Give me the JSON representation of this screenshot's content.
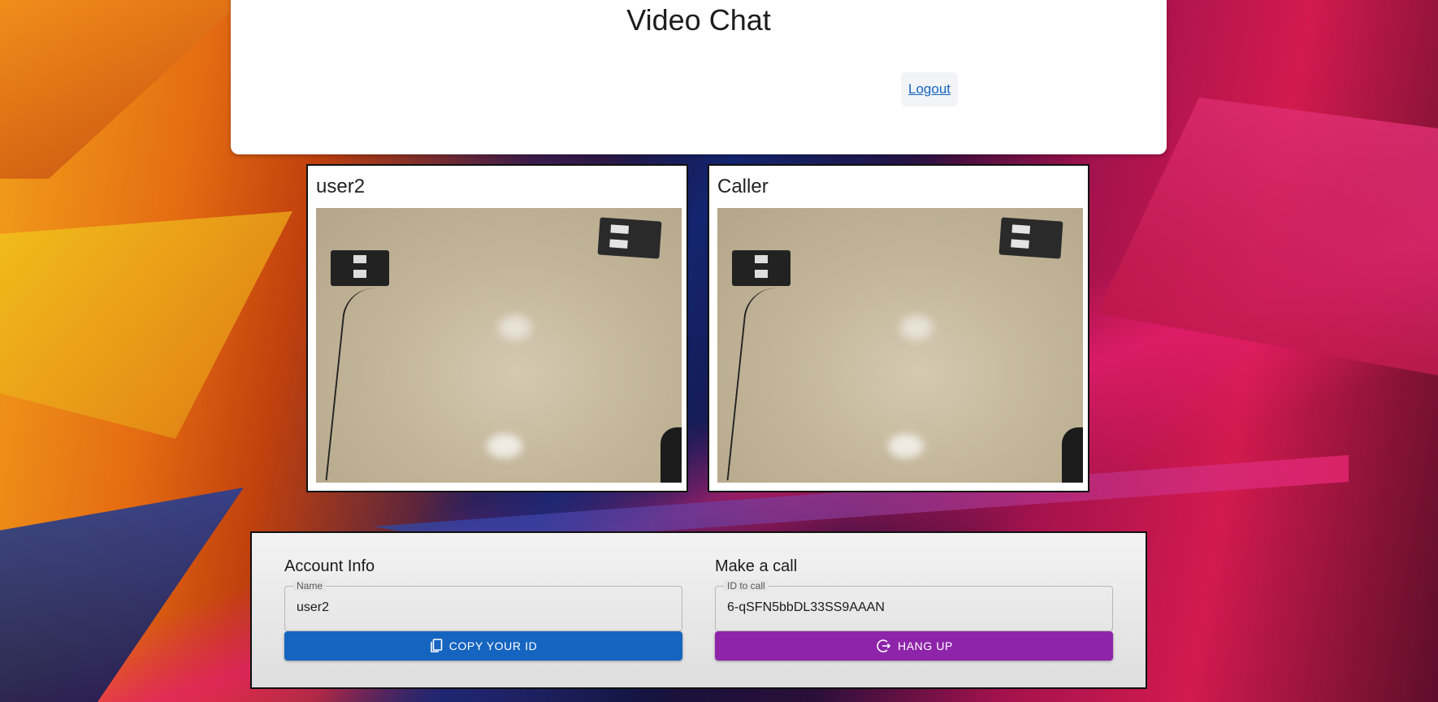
{
  "header": {
    "title": "Video Chat",
    "logout_label": "Logout"
  },
  "videos": [
    {
      "label": "user2"
    },
    {
      "label": "Caller"
    }
  ],
  "account": {
    "section_title": "Account Info",
    "name_label": "Name",
    "name_value": "user2",
    "copy_button_label": "COPY YOUR ID",
    "copy_icon": "copy-icon"
  },
  "call": {
    "section_title": "Make a call",
    "id_label": "ID to call",
    "id_value": "6-qSFN5bbDL33SS9AAAN",
    "hangup_button_label": "HANG UP",
    "hangup_icon": "phone-hangup-icon"
  },
  "colors": {
    "primary": "#1565c0",
    "hangup": "#8e24aa"
  }
}
